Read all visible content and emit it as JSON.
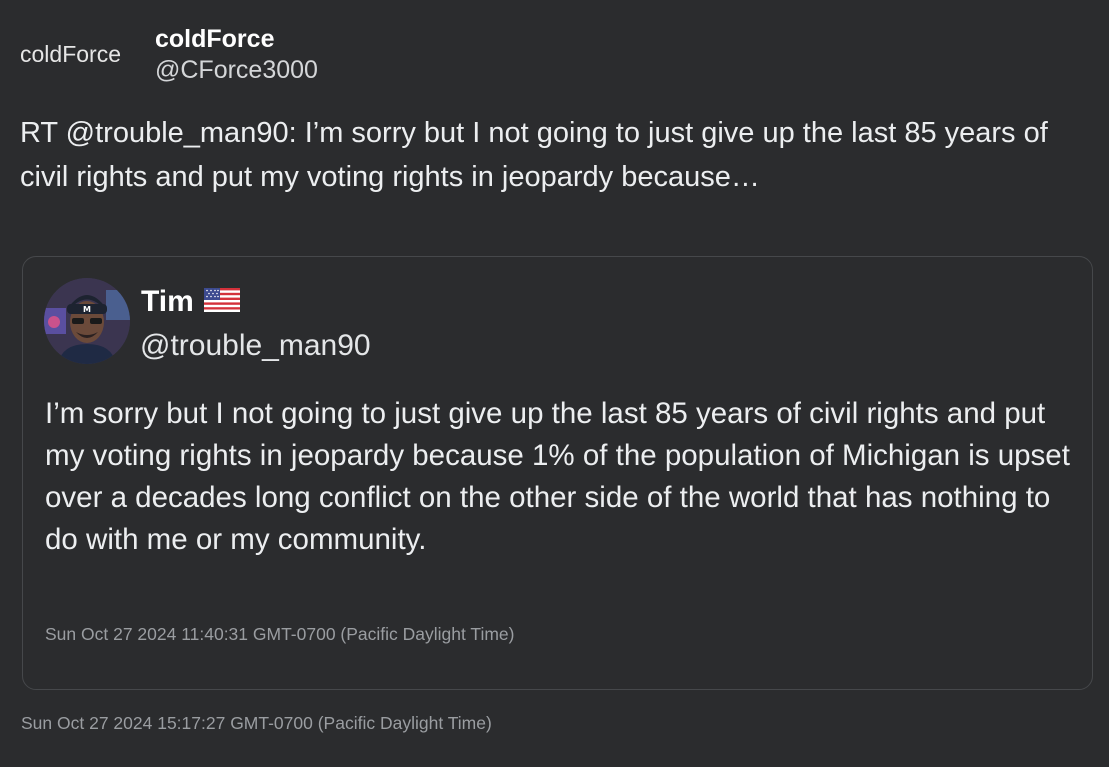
{
  "author": {
    "avatar_alt": "coldForce",
    "display_name": "coldForce",
    "handle": "@CForce3000"
  },
  "tweet": {
    "text": "RT @trouble_man90: I’m sorry but I not going to just give up the last 85 years of civil rights and put my voting rights in jeopardy because…",
    "timestamp": "Sun Oct 27 2024 15:17:27 GMT-0700 (Pacific Daylight Time)"
  },
  "quoted": {
    "display_name": "Tim",
    "flag_icon": "us-flag-icon",
    "handle": "@trouble_man90",
    "text": "I’m sorry but I not going to just give up the last 85 years of civil rights and put my voting rights in jeopardy because 1% of the population of Michigan is upset over a decades long conflict on the other side of the world that has nothing to do with me or my community.",
    "timestamp": "Sun Oct 27 2024 11:40:31 GMT-0700 (Pacific Daylight Time)"
  },
  "colors": {
    "background": "#2b2c2e",
    "border": "#46484b",
    "muted_text": "#9a9da1"
  }
}
